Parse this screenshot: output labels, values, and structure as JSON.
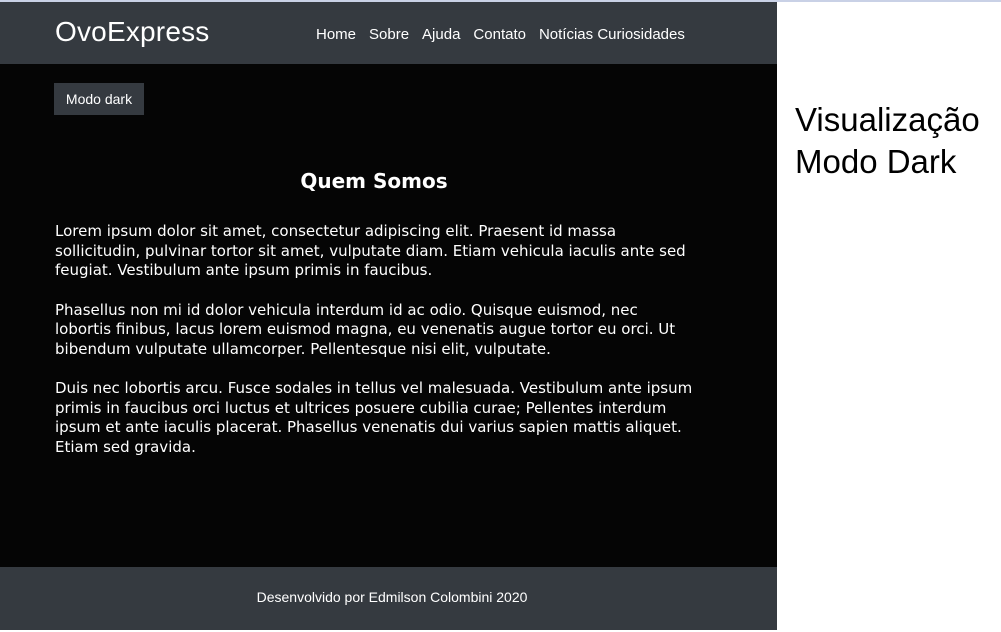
{
  "header": {
    "brand": "OvoExpress",
    "nav": [
      "Home",
      "Sobre",
      "Ajuda",
      "Contato",
      "Notícias Curiosidades"
    ]
  },
  "mode_button": "Modo dark",
  "main": {
    "title": "Quem Somos",
    "paragraphs": [
      "Lorem ipsum dolor sit amet, consectetur adipiscing elit. Praesent id massa sollicitudin, pulvinar tortor sit amet, vulputate diam. Etiam vehicula iaculis ante sed feugiat. Vestibulum ante ipsum primis in faucibus.",
      "Phasellus non mi id dolor vehicula interdum id ac odio. Quisque euismod, nec lobortis finibus, lacus lorem euismod magna, eu venenatis augue tortor eu orci. Ut bibendum vulputate ullamcorper. Pellentesque nisi elit, vulputate.",
      "Duis nec lobortis arcu. Fusce sodales in tellus vel malesuada. Vestibulum ante ipsum primis in faucibus orci luctus et ultrices posuere cubilia curae; Pellentes interdum ipsum et ante iaculis placerat. Phasellus venenatis dui varius sapien mattis aliquet. Etiam sed gravida."
    ]
  },
  "footer": {
    "text": "Desenvolvido por Edmilson Colombini 2020"
  },
  "annotation": {
    "line1": "Visualização",
    "line2": "Modo Dark"
  },
  "colors": {
    "navbar": "#353a40",
    "page_background": "#050505",
    "text": "#ffffff"
  }
}
